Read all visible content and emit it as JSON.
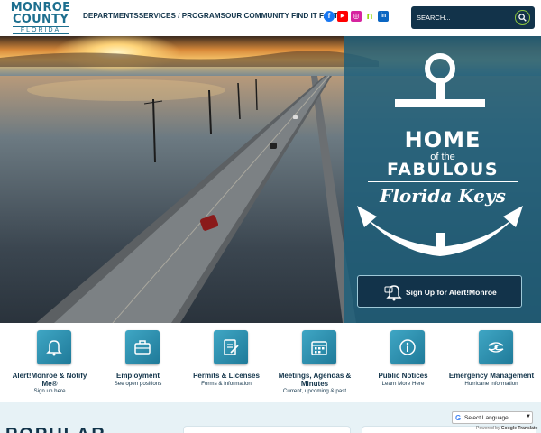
{
  "logo": {
    "line1": "MONROE",
    "line2": "COUNTY",
    "line3": "FLORIDA"
  },
  "nav": [
    "DEPARTMENTS",
    "SERVICES / PROGRAMS",
    "OUR COMMUNITY",
    "FIND IT FAST"
  ],
  "social": [
    {
      "name": "facebook-icon",
      "color": "#1877f2",
      "glyph": "f"
    },
    {
      "name": "youtube-icon",
      "color": "#ff0000",
      "glyph": "▶"
    },
    {
      "name": "instagram-icon",
      "color": "#d6249f",
      "glyph": "◎"
    },
    {
      "name": "nextdoor-icon",
      "color": "#8ed500",
      "glyph": "n"
    },
    {
      "name": "linkedin-icon",
      "color": "#0a66c2",
      "glyph": "in"
    }
  ],
  "search": {
    "placeholder": "SEARCH..."
  },
  "hero": {
    "home": "HOME",
    "of_the": "of the",
    "fabulous": "FABULOUS",
    "florida_keys": "Florida Keys",
    "alert_button": "Sign Up for Alert!Monroe"
  },
  "quick_links": [
    {
      "title": "Alert!Monroe & Notify Me®",
      "sub": "Sign up here",
      "icon": "bell-icon"
    },
    {
      "title": "Employment",
      "sub": "See open positions",
      "icon": "briefcase-icon"
    },
    {
      "title": "Permits & Licenses",
      "sub": "Forms & information",
      "icon": "document-edit-icon"
    },
    {
      "title": "Meetings, Agendas & Minutes",
      "sub": "Current, upcoming & past",
      "icon": "calendar-icon"
    },
    {
      "title": "Public Notices",
      "sub": "Learn More Here",
      "icon": "info-icon"
    },
    {
      "title": "Emergency Management",
      "sub": "Hurricane information",
      "icon": "hurricane-icon"
    }
  ],
  "bottom": {
    "popular": "POPULAR",
    "translate_label": "Select Language",
    "powered_by": "Powered by",
    "google": "Google",
    "translate_word": "Translate"
  }
}
